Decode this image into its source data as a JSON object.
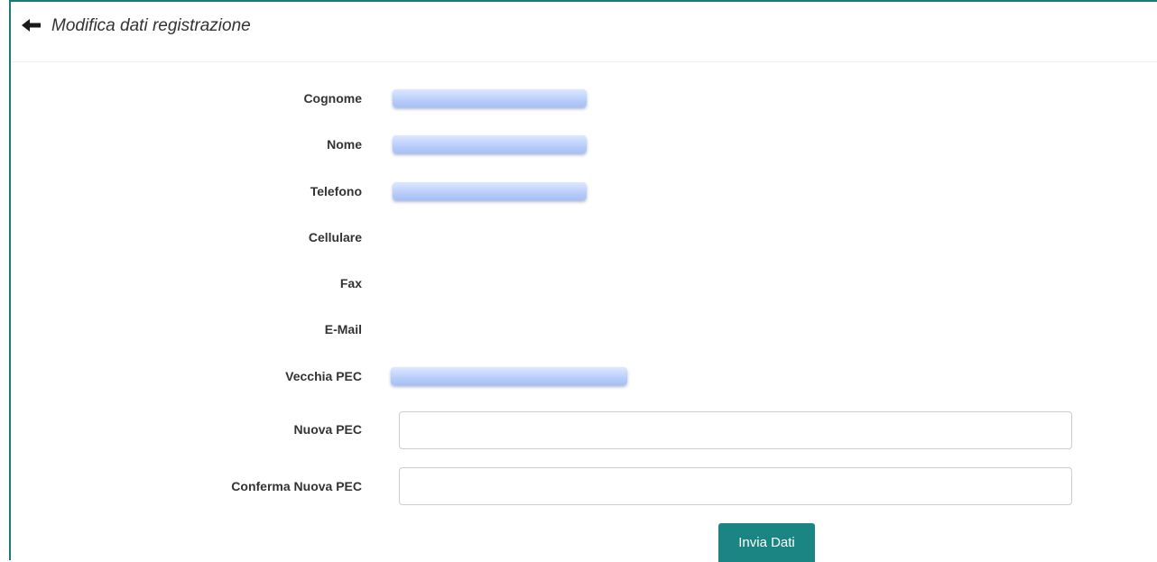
{
  "header": {
    "back_icon": "arrow-left-icon",
    "title": "Modifica dati registrazione"
  },
  "form": {
    "cognome_label": "Cognome",
    "nome_label": "Nome",
    "telefono_label": "Telefono",
    "cellulare_label": "Cellulare",
    "fax_label": "Fax",
    "email_label": "E-Mail",
    "vecchia_pec_label": "Vecchia PEC",
    "nuova_pec_label": "Nuova PEC",
    "nuova_pec_value": "",
    "conferma_pec_label": "Conferma Nuova PEC",
    "conferma_pec_value": "",
    "submit_label": "Invia Dati"
  },
  "colors": {
    "accent": "#1b8583",
    "border_accent": "#1b7a78",
    "redacted_value": "#b9cdfb"
  }
}
